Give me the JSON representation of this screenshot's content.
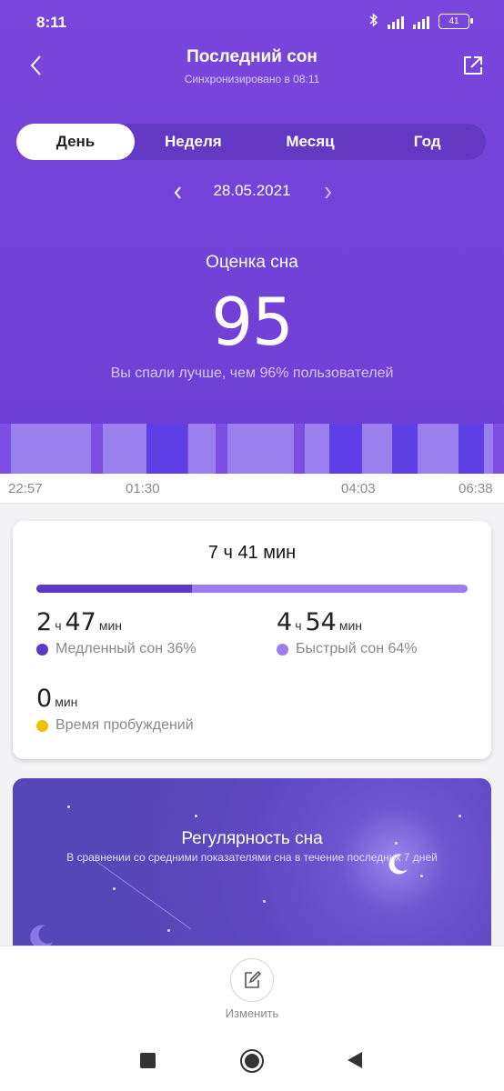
{
  "status_bar": {
    "time": "8:11",
    "battery": "41"
  },
  "header": {
    "title": "Последний сон",
    "subtitle": "Синхронизировано в 08:11"
  },
  "tabs": [
    {
      "label": "День",
      "active": true
    },
    {
      "label": "Неделя",
      "active": false
    },
    {
      "label": "Месяц",
      "active": false
    },
    {
      "label": "Год",
      "active": false
    }
  ],
  "date": "28.05.2021",
  "score": {
    "label": "Оценка сна",
    "value": "95",
    "description": "Вы спали лучше, чем 96% пользователей"
  },
  "timeline": {
    "labels": [
      "22:57",
      "01:30",
      "04:03",
      "06:38"
    ],
    "colors": {
      "deep": "#5e3fe6",
      "light": "#9a80ee",
      "background": "#7e4ee3"
    }
  },
  "summary": {
    "total": "7 ч 41 мин",
    "deep_share": 36,
    "deep": {
      "hours": "2",
      "h_unit": "ч",
      "minutes": "47",
      "m_unit": "мин",
      "label": "Медленный сон 36%",
      "color": "#5b39c8"
    },
    "light": {
      "hours": "4",
      "h_unit": "ч",
      "minutes": "54",
      "m_unit": "мин",
      "label": "Быстрый сон 64%",
      "color": "#9b7df0"
    },
    "awake": {
      "minutes": "0",
      "m_unit": "мин",
      "label": "Время пробуждений",
      "color": "#f2bf00"
    }
  },
  "regularity": {
    "title": "Регулярность сна",
    "subtitle": "В сравнении со средними показателями сна в течение последних 7 дней"
  },
  "edit": {
    "label": "Изменить"
  }
}
